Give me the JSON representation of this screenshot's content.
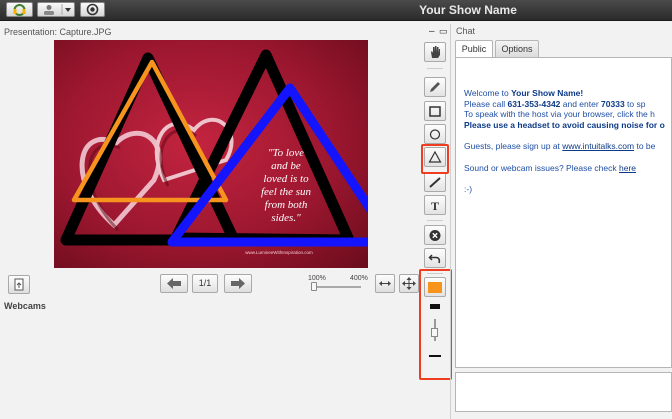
{
  "app": {
    "show_name": "Your Show Name"
  },
  "presentation": {
    "label": "Presentation: Capture.JPG",
    "slide_quote": [
      "\"To love",
      "and be",
      "loved is to",
      "feel the sun",
      "from both",
      "sides.\""
    ],
    "slide_url": "www.LumineeWithInspiration.com",
    "page_indicator": "1/1",
    "zoom_min": "100%",
    "zoom_max": "400%",
    "zoom_level": 0.0
  },
  "webcams": {
    "label": "Webcams"
  },
  "toolbar": {
    "tools": [
      "hand-tool",
      "pencil-tool",
      "rectangle-tool",
      "ellipse-tool",
      "triangle-tool",
      "line-tool",
      "text-tool",
      "clear-tool",
      "undo-tool"
    ],
    "selected_tool": "triangle-tool",
    "selected_color": "#f7941d",
    "brush_level": 0.4
  },
  "chat": {
    "title": "Chat",
    "tabs": [
      "Public",
      "Options"
    ],
    "active_tab": "Public",
    "lines": {
      "welcome_prefix": "Welcome to ",
      "welcome_name": "Your Show Name!",
      "call_prefix": " Please call ",
      "phone": "631-353-4342",
      "call_mid": " and enter ",
      "code": "70333",
      "call_suffix": " to sp",
      "browser": "To speak with the host via your browser, click the h",
      "headset": "Please use a headset to avoid causing noise for o",
      "guests_prefix": "Guests, please sign up at ",
      "guests_link": "www.intuitalks.com",
      "guests_suffix": " to be",
      "sound_prefix": "Sound or webcam issues? Please check ",
      "sound_link": "here",
      "smiley": ":-)"
    }
  },
  "colors": {
    "accent": "#ef3d22",
    "orange": "#f7941d",
    "blue": "#1414ff",
    "black": "#000000"
  }
}
